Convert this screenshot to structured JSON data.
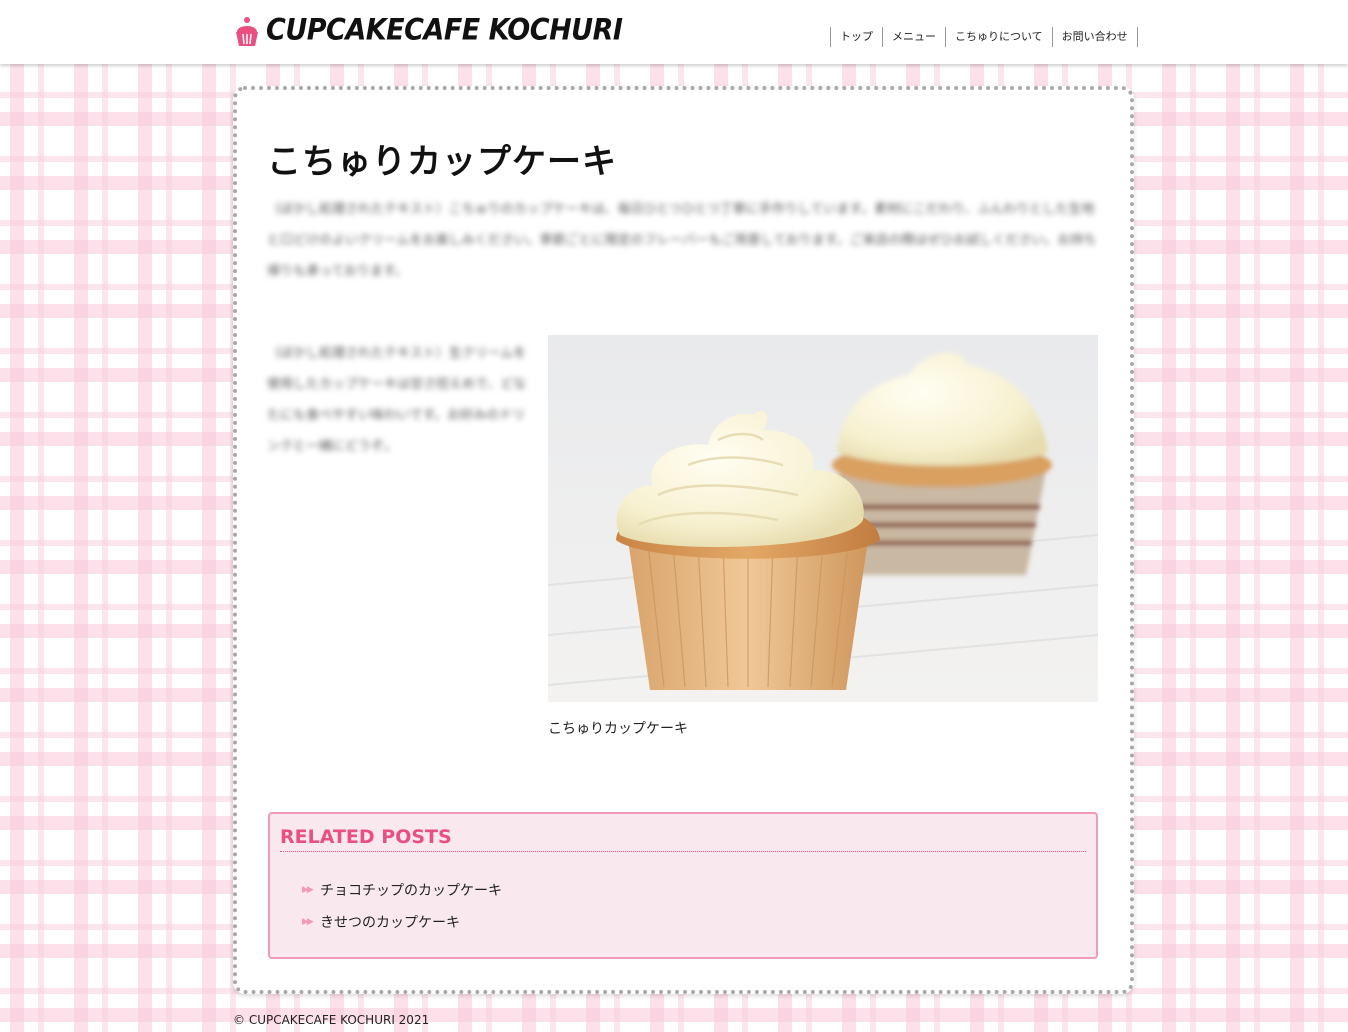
{
  "header": {
    "logo_text": "CUPCAKECAFE KOCHURI",
    "logo_icon": "cupcake-icon",
    "nav": [
      {
        "label": "トップ"
      },
      {
        "label": "メニュー"
      },
      {
        "label": "こちゅりについて"
      },
      {
        "label": "お問い合わせ"
      }
    ]
  },
  "main": {
    "title": "こちゅりカップケーキ",
    "intro_text": "（ぼかし処理されたテキスト）こちゅりのカップケーキは、毎日ひとつひとつ丁寧に手作りしています。素材にこだわり、ふんわりとした生地と口どけのよいクリームをお楽しみください。季節ごとに限定のフレーバーもご用意しております。ご来店の際はぜひお試しください。お持ち帰りも承っております。",
    "side_text": "（ぼかし処理されたテキスト）生クリームを使用したカップケーキは甘さ控えめで、どなたにも食べやすい味わいです。お好みのドリンクと一緒にどうぞ。",
    "image_caption": "こちゅりカップケーキ"
  },
  "related": {
    "title": "RELATED POSTS",
    "items": [
      {
        "label": "チョコチップのカップケーキ"
      },
      {
        "label": "きせつのカップケーキ"
      }
    ]
  },
  "footer": {
    "copyright": "© CUPCAKECAFE KOCHURI 2021"
  },
  "colors": {
    "accent_pink": "#e94f80",
    "related_bg": "#f9e9ee",
    "related_border": "#f19abb",
    "plaid_pink": "#f9c8da"
  }
}
